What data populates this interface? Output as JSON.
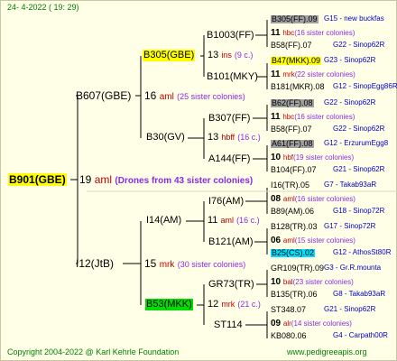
{
  "date": "24-  4-2022  ( 19:  29)",
  "root": {
    "name": "B901(GBE)",
    "count": "19",
    "trait": "aml",
    "note": "(Drones from 43 sister colonies)"
  },
  "gen1": [
    {
      "name": "B607(GBE)",
      "count": "16",
      "trait": "aml",
      "note": "(25 sister colonies)"
    },
    {
      "name": "I12(JtB)",
      "count": "15",
      "trait": "mrk",
      "note": "(30 sister colonies)"
    }
  ],
  "gen2": [
    {
      "name": "B305(GBE)",
      "count": "13",
      "trait": "ins",
      "note": "(9 c.)"
    },
    {
      "name": "B30(GV)",
      "count": "13",
      "trait": "hbff",
      "note": "(16 c.)"
    },
    {
      "name": "I14(AM)",
      "count": "11",
      "trait": "aml",
      "note": "(16 c.)"
    },
    {
      "name": "B53(MKK)",
      "count": "12",
      "trait": "mrk",
      "note": "(21 c.)"
    }
  ],
  "gen3": [
    {
      "name": "B1003(FF)"
    },
    {
      "name": "B101(MKY)"
    },
    {
      "name": "B307(FF)"
    },
    {
      "name": "A144(FF)"
    },
    {
      "name": "I76(AM)"
    },
    {
      "name": "B121(AM)"
    },
    {
      "name": "GR73(TR)"
    },
    {
      "name": "ST114"
    }
  ],
  "gen4": [
    {
      "top": "B305(FF).09",
      "topcol": "G15 - new buckfas",
      "count": "11",
      "trait": "hbc",
      "note": "(16 sister colonies)",
      "bot": "B58(FF).07",
      "botcol": "G22 - Sinop62R"
    },
    {
      "top": "B47(MKK).09",
      "topcol": "G23 - Sinop62R",
      "count": "11",
      "trait": "mrk",
      "note": "(22 sister colonies)",
      "bot": "B181(MKR).08",
      "botcol": "G12 - SinopEgg86R"
    },
    {
      "top": "B62(FF).08",
      "topcol": "G22 - Sinop62R",
      "count": "11",
      "trait": "hbc",
      "note": "(16 sister colonies)",
      "bot": "B58(FF).07",
      "botcol": "G22 - Sinop62R"
    },
    {
      "top": "A61(FF).08",
      "topcol": "G12 - ErzurumEgg8",
      "count": "10",
      "trait": "hbf",
      "note": "(19 sister colonies)",
      "bot": "B104(FF).07",
      "botcol": "G21 - Sinop62R"
    },
    {
      "top": "I16(TR).05",
      "topcol": "G7 - Takab93aR",
      "count": "08",
      "trait": "aml",
      "note": "(16 sister colonies)",
      "bot": "B89(AM).06",
      "botcol": "G18 - Sinop72R"
    },
    {
      "top": "B128(TR).03",
      "topcol": "G17 - Sinop72R",
      "count": "06",
      "trait": "aml",
      "note": "(15 sister colonies)",
      "bot": "B25(CS).02",
      "botcol": "G12 - AthosSt80R"
    },
    {
      "top": "GR109(TR).09",
      "topcol": "G3 - Gr.R.mounta",
      "count": "10",
      "trait": "bal",
      "note": "(23 sister colonies)",
      "bot": "B135(TR).06",
      "botcol": "G8 - Takab93aR"
    },
    {
      "top": "ST348.07",
      "topcol": "G21 - Sinop62R",
      "count": "09",
      "trait": "alr",
      "note": "(14 sister colonies)",
      "bot": "KB080.06",
      "botcol": "G4 - Carpath00R"
    }
  ],
  "footer": {
    "left": "Copyright 2004-2022 @ Karl Kehrle Foundation",
    "right": "www.pedigreeapis.org"
  },
  "colors": {
    "background": "#ffffe8",
    "highlight_yellow": "#ffff00",
    "highlight_gray": "#a0a0a0",
    "highlight_green": "#00dd00",
    "highlight_cyan": "#00e0ff",
    "count_red": "#c00000",
    "note_purple": "#8a2be2",
    "colony_blue": "#0000c8",
    "footer_green": "#008000"
  }
}
